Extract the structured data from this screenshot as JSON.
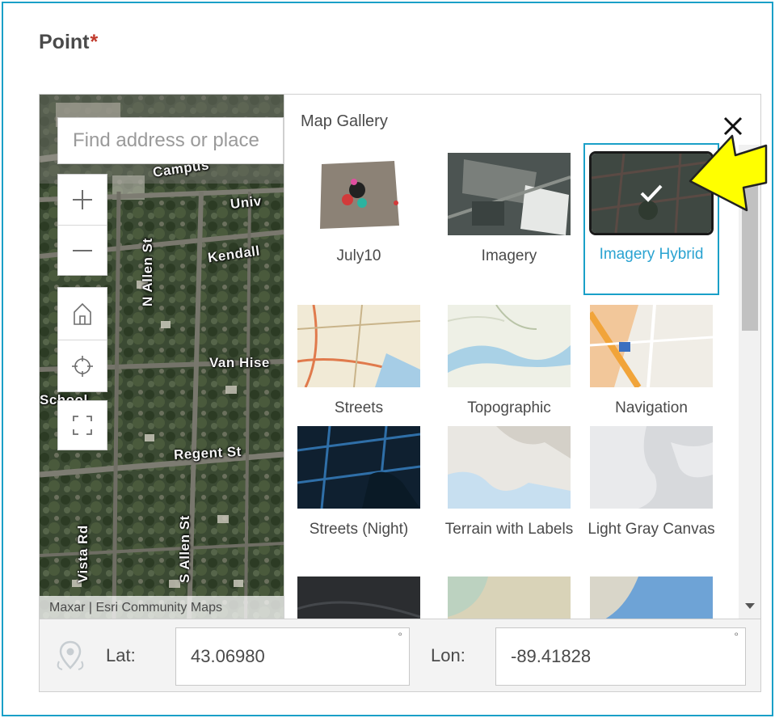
{
  "field": {
    "label": "Point",
    "required_mark": "*"
  },
  "map": {
    "search_placeholder": "Find address or place",
    "attribution": "Maxar | Esri Community Maps",
    "zoom_in": "+",
    "zoom_out": "—",
    "street_labels": [
      "Campus",
      "Univ",
      "Kendall",
      "N Allen St",
      "Van Hise",
      "Regent St",
      "Vista Rd",
      "S Allen St",
      "School"
    ]
  },
  "gallery": {
    "title": "Map Gallery",
    "close": "✕",
    "basemaps": [
      {
        "label": "July10",
        "selected": false
      },
      {
        "label": "Imagery",
        "selected": false
      },
      {
        "label": "Imagery Hybrid",
        "selected": true
      },
      {
        "label": "Streets",
        "selected": false
      },
      {
        "label": "Topographic",
        "selected": false
      },
      {
        "label": "Navigation",
        "selected": false
      },
      {
        "label": "Streets (Night)",
        "selected": false
      },
      {
        "label": "Terrain with Labels",
        "selected": false
      },
      {
        "label": "Light Gray Canvas",
        "selected": false
      }
    ]
  },
  "coordinates": {
    "lat_label": "Lat:",
    "lat_value": "43.06980",
    "lon_label": "Lon:",
    "lon_value": "-89.41828",
    "degree_symbol": "°"
  },
  "colors": {
    "accent": "#1aa0c8",
    "selected_text": "#2aa3d1",
    "required": "#c0392b",
    "pointer": "#ffff00"
  }
}
